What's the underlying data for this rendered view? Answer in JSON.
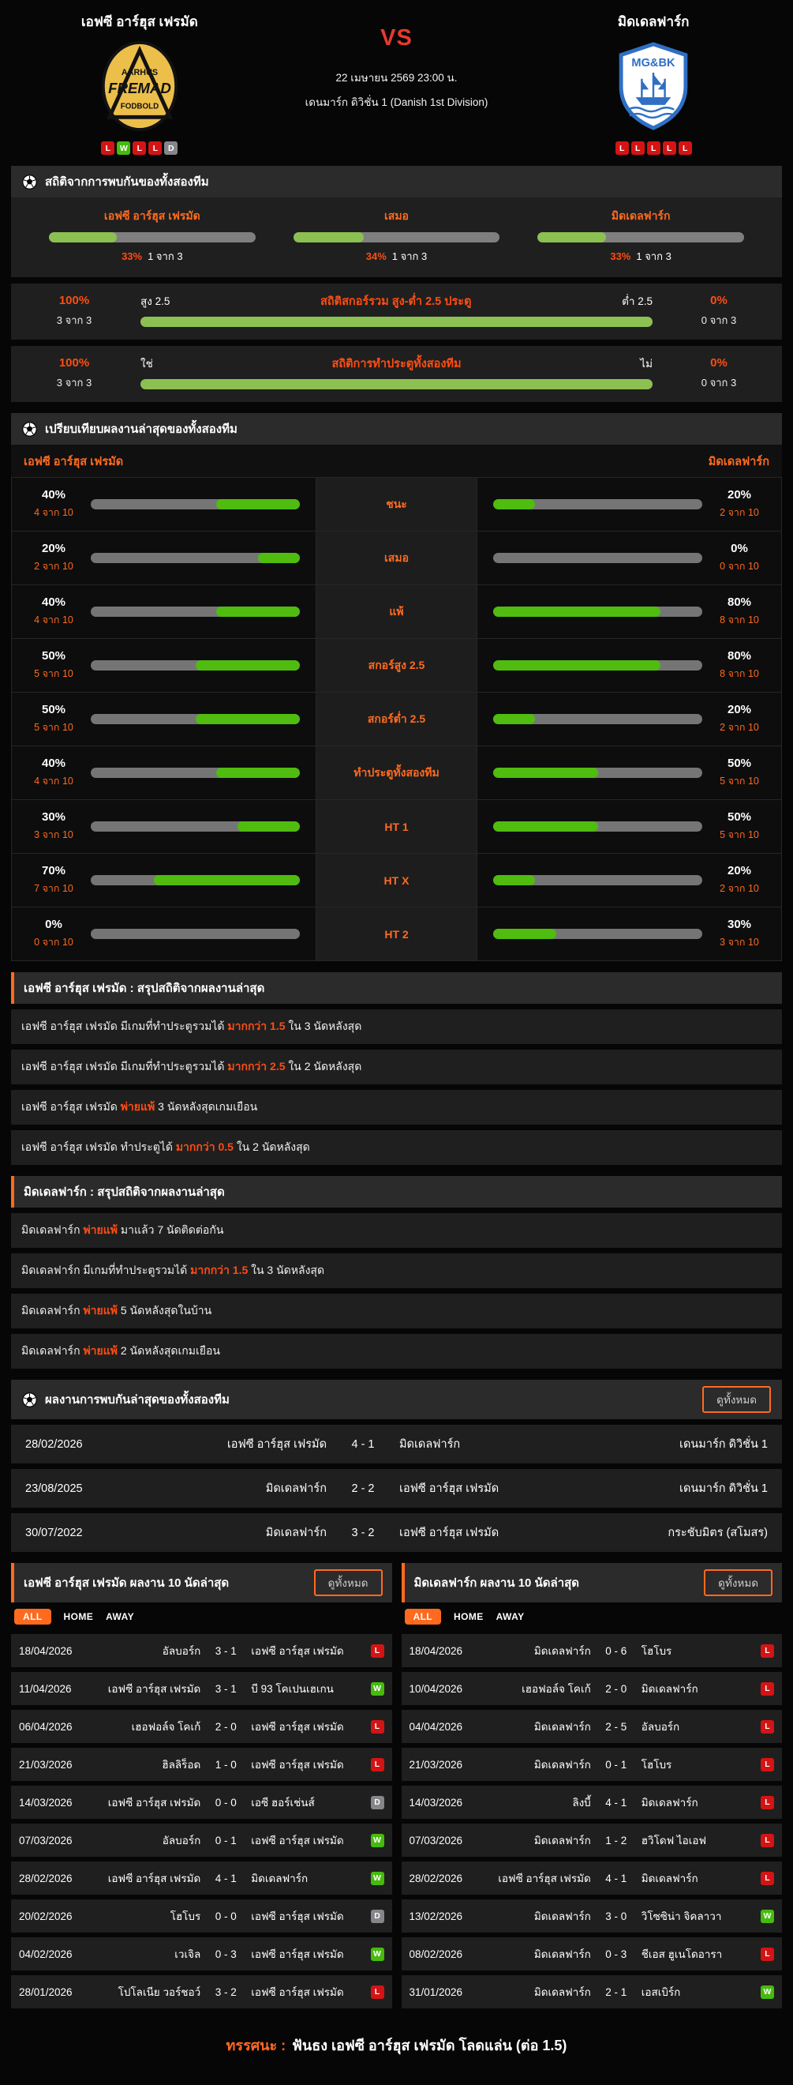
{
  "header": {
    "home": {
      "name": "เอฟซี อาร์ฮุส เฟรมัด",
      "logo": [
        "AARHUS",
        "FREMAD",
        "FODBOLD"
      ],
      "form": [
        "L",
        "W",
        "L",
        "L",
        "D"
      ]
    },
    "away": {
      "name": "มิดเดลฟาร์ก",
      "logo_text": "MG&BK",
      "form": [
        "L",
        "L",
        "L",
        "L",
        "L"
      ]
    },
    "vs": "VS",
    "datetime": "22 เมษายน 2569 23:00 น.",
    "league": "เดนมาร์ก ดิวิชั่น 1 (Danish 1st Division)"
  },
  "h2h_stats": {
    "title": "สถิติจากการพบกันของทั้งสองทีม",
    "columns": [
      {
        "label": "เอฟซี อาร์ฮุส เฟรมัด",
        "pct": "33%",
        "count": "1 จาก 3",
        "fill": 33
      },
      {
        "label": "เสมอ",
        "pct": "34%",
        "count": "1 จาก 3",
        "fill": 34
      },
      {
        "label": "มิดเดลฟาร์ก",
        "pct": "33%",
        "count": "1 จาก 3",
        "fill": 33
      }
    ],
    "rows": [
      {
        "left_pct": "100%",
        "left_count": "3 จาก 3",
        "left_label": "สูง 2.5",
        "title": "สถิติสกอร์รวม สูง-ต่ำ 2.5 ประตู",
        "right_label": "ต่ำ 2.5",
        "right_pct": "0%",
        "right_count": "0 จาก 3",
        "fill": 100
      },
      {
        "left_pct": "100%",
        "left_count": "3 จาก 3",
        "left_label": "ใช่",
        "title": "สถิติการทำประตูทั้งสองทีม",
        "right_label": "ไม่",
        "right_pct": "0%",
        "right_count": "0 จาก 3",
        "fill": 100
      }
    ]
  },
  "comparison": {
    "title": "เปรียบเทียบผลงานล่าสุดของทั้งสองทีม",
    "home_label": "เอฟซี อาร์ฮุส เฟรมัด",
    "away_label": "มิดเดลฟาร์ก",
    "rows": [
      {
        "label": "ชนะ",
        "home_pct": "40%",
        "home_count": "4 จาก 10",
        "home_fill": 40,
        "away_pct": "20%",
        "away_count": "2 จาก 10",
        "away_fill": 20
      },
      {
        "label": "เสมอ",
        "home_pct": "20%",
        "home_count": "2 จาก 10",
        "home_fill": 20,
        "away_pct": "0%",
        "away_count": "0 จาก 10",
        "away_fill": 0
      },
      {
        "label": "แพ้",
        "home_pct": "40%",
        "home_count": "4 จาก 10",
        "home_fill": 40,
        "away_pct": "80%",
        "away_count": "8 จาก 10",
        "away_fill": 80
      },
      {
        "label": "สกอร์สูง 2.5",
        "home_pct": "50%",
        "home_count": "5 จาก 10",
        "home_fill": 50,
        "away_pct": "80%",
        "away_count": "8 จาก 10",
        "away_fill": 80
      },
      {
        "label": "สกอร์ต่ำ 2.5",
        "home_pct": "50%",
        "home_count": "5 จาก 10",
        "home_fill": 50,
        "away_pct": "20%",
        "away_count": "2 จาก 10",
        "away_fill": 20
      },
      {
        "label": "ทำประตูทั้งสองทีม",
        "home_pct": "40%",
        "home_count": "4 จาก 10",
        "home_fill": 40,
        "away_pct": "50%",
        "away_count": "5 จาก 10",
        "away_fill": 50
      },
      {
        "label": "HT 1",
        "home_pct": "30%",
        "home_count": "3 จาก 10",
        "home_fill": 30,
        "away_pct": "50%",
        "away_count": "5 จาก 10",
        "away_fill": 50
      },
      {
        "label": "HT X",
        "home_pct": "70%",
        "home_count": "7 จาก 10",
        "home_fill": 70,
        "away_pct": "20%",
        "away_count": "2 จาก 10",
        "away_fill": 20
      },
      {
        "label": "HT 2",
        "home_pct": "0%",
        "home_count": "0 จาก 10",
        "home_fill": 0,
        "away_pct": "30%",
        "away_count": "3 จาก 10",
        "away_fill": 30
      }
    ]
  },
  "home_summary": {
    "title": "เอฟซี อาร์ฮุส เฟรมัด : สรุปสถิติจากผลงานล่าสุด",
    "rows": [
      {
        "pre": "เอฟซี อาร์ฮุส เฟรมัด  มีเกมที่ทำประตูรวมได้ ",
        "hl": "มากกว่า 1.5",
        "post": " ใน 3 นัดหลังสุด"
      },
      {
        "pre": "เอฟซี อาร์ฮุส เฟรมัด  มีเกมที่ทำประตูรวมได้ ",
        "hl": "มากกว่า 2.5",
        "post": " ใน 2 นัดหลังสุด"
      },
      {
        "pre": "เอฟซี อาร์ฮุส เฟรมัด  ",
        "hl": "พ่ายแพ้",
        "post": " 3  นัดหลังสุดเกมเยือน"
      },
      {
        "pre": "เอฟซี อาร์ฮุส เฟรมัด  ทำประตูได้ ",
        "hl": "มากกว่า 0.5",
        "post": " ใน 2 นัดหลังสุด"
      }
    ]
  },
  "away_summary": {
    "title": "มิดเดลฟาร์ก : สรุปสถิติจากผลงานล่าสุด",
    "rows": [
      {
        "pre": "มิดเดลฟาร์ก  ",
        "hl": "พ่ายแพ้",
        "post": " มาแล้ว 7 นัดติดต่อกัน"
      },
      {
        "pre": "มิดเดลฟาร์ก  มีเกมที่ทำประตูรวมได้ ",
        "hl": "มากกว่า 1.5",
        "post": " ใน 3 นัดหลังสุด"
      },
      {
        "pre": "มิดเดลฟาร์ก  ",
        "hl": "พ่ายแพ้",
        "post": " 5  นัดหลังสุดในบ้าน"
      },
      {
        "pre": "มิดเดลฟาร์ก  ",
        "hl": "พ่ายแพ้",
        "post": " 2  นัดหลังสุดเกมเยือน"
      }
    ]
  },
  "h2h_results": {
    "title": "ผลงานการพบกันล่าสุดของทั้งสองทีม",
    "view_all": "ดูทั้งหมด",
    "rows": [
      {
        "date": "28/02/2026",
        "home": "เอฟซี อาร์ฮุส เฟรมัด",
        "score": "4 - 1",
        "away": "มิดเดลฟาร์ก",
        "league": "เดนมาร์ก ดิวิชั่น 1"
      },
      {
        "date": "23/08/2025",
        "home": "มิดเดลฟาร์ก",
        "score": "2 - 2",
        "away": "เอฟซี อาร์ฮุส เฟรมัด",
        "league": "เดนมาร์ก ดิวิชั่น 1"
      },
      {
        "date": "30/07/2022",
        "home": "มิดเดลฟาร์ก",
        "score": "3 - 2",
        "away": "เอฟซี อาร์ฮุส เฟรมัด",
        "league": "กระชับมิตร (สโมสร)"
      }
    ]
  },
  "recent_panels": [
    {
      "title": "เอฟซี อาร์ฮุส เฟรมัด ผลงาน 10 นัดล่าสุด",
      "view_all": "ดูทั้งหมด",
      "tabs": [
        "ALL",
        "HOME",
        "AWAY"
      ],
      "rows": [
        {
          "date": "18/04/2026",
          "home": "อัลบอร์ก",
          "score": "3 - 1",
          "away": "เอฟซี อาร์ฮุส เฟรมัด",
          "result": "L"
        },
        {
          "date": "11/04/2026",
          "home": "เอฟซี อาร์ฮุส เฟรมัด",
          "score": "3 - 1",
          "away": "บี 93 โคเปนเฮเกน",
          "result": "W"
        },
        {
          "date": "06/04/2026",
          "home": "เฮอฟอล์จ โคเก้",
          "score": "2 - 0",
          "away": "เอฟซี อาร์ฮุส เฟรมัด",
          "result": "L"
        },
        {
          "date": "21/03/2026",
          "home": "ฮิลลิร็อด",
          "score": "1 - 0",
          "away": "เอฟซี อาร์ฮุส เฟรมัด",
          "result": "L"
        },
        {
          "date": "14/03/2026",
          "home": "เอฟซี อาร์ฮุส เฟรมัด",
          "score": "0 - 0",
          "away": "เอซี ฮอร์เช่นส์",
          "result": "D"
        },
        {
          "date": "07/03/2026",
          "home": "อัลบอร์ก",
          "score": "0 - 1",
          "away": "เอฟซี อาร์ฮุส เฟรมัด",
          "result": "W"
        },
        {
          "date": "28/02/2026",
          "home": "เอฟซี อาร์ฮุส เฟรมัด",
          "score": "4 - 1",
          "away": "มิดเดลฟาร์ก",
          "result": "W"
        },
        {
          "date": "20/02/2026",
          "home": "โฮโบร",
          "score": "0 - 0",
          "away": "เอฟซี อาร์ฮุส เฟรมัด",
          "result": "D"
        },
        {
          "date": "04/02/2026",
          "home": "เวเจิล",
          "score": "0 - 3",
          "away": "เอฟซี อาร์ฮุส เฟรมัด",
          "result": "W"
        },
        {
          "date": "28/01/2026",
          "home": "โปโลเนีย วอร์ชอว์",
          "score": "3 - 2",
          "away": "เอฟซี อาร์ฮุส เฟรมัด",
          "result": "L"
        }
      ]
    },
    {
      "title": "มิดเดลฟาร์ก ผลงาน 10 นัดล่าสุด",
      "view_all": "ดูทั้งหมด",
      "tabs": [
        "ALL",
        "HOME",
        "AWAY"
      ],
      "rows": [
        {
          "date": "18/04/2026",
          "home": "มิดเดลฟาร์ก",
          "score": "0 - 6",
          "away": "โฮโบร",
          "result": "L"
        },
        {
          "date": "10/04/2026",
          "home": "เฮอฟอล์จ โคเก้",
          "score": "2 - 0",
          "away": "มิดเดลฟาร์ก",
          "result": "L"
        },
        {
          "date": "04/04/2026",
          "home": "มิดเดลฟาร์ก",
          "score": "2 - 5",
          "away": "อัลบอร์ก",
          "result": "L"
        },
        {
          "date": "21/03/2026",
          "home": "มิดเดลฟาร์ก",
          "score": "0 - 1",
          "away": "โฮโบร",
          "result": "L"
        },
        {
          "date": "14/03/2026",
          "home": "ลิงบี้",
          "score": "4 - 1",
          "away": "มิดเดลฟาร์ก",
          "result": "L"
        },
        {
          "date": "07/03/2026",
          "home": "มิดเดลฟาร์ก",
          "score": "1 - 2",
          "away": "ฮวิโดฟ ไอเอฟ",
          "result": "L"
        },
        {
          "date": "28/02/2026",
          "home": "เอฟซี อาร์ฮุส เฟรมัด",
          "score": "4 - 1",
          "away": "มิดเดลฟาร์ก",
          "result": "L"
        },
        {
          "date": "13/02/2026",
          "home": "มิดเดลฟาร์ก",
          "score": "3 - 0",
          "away": "วิโซซิน่า จิคลาวา",
          "result": "W"
        },
        {
          "date": "08/02/2026",
          "home": "มิดเดลฟาร์ก",
          "score": "0 - 3",
          "away": "ชีเอส ฮูเนโดอารา",
          "result": "L"
        },
        {
          "date": "31/01/2026",
          "home": "มิดเดลฟาร์ก",
          "score": "2 - 1",
          "away": "เอสเบิร์ก",
          "result": "W"
        }
      ]
    }
  ],
  "footer": {
    "tag": "ทรรศนะ :",
    "text": "ฟันธง เอฟซี อาร์ฮุส เฟรมัด โลดแล่น (ต่อ 1.5)"
  },
  "colors": {
    "accent": "#ff6a1f",
    "green_soft": "#8cc152",
    "green_vivid": "#4fbc0f",
    "win": "#46bb0d",
    "lose": "#d41414",
    "draw": "#85858a"
  }
}
